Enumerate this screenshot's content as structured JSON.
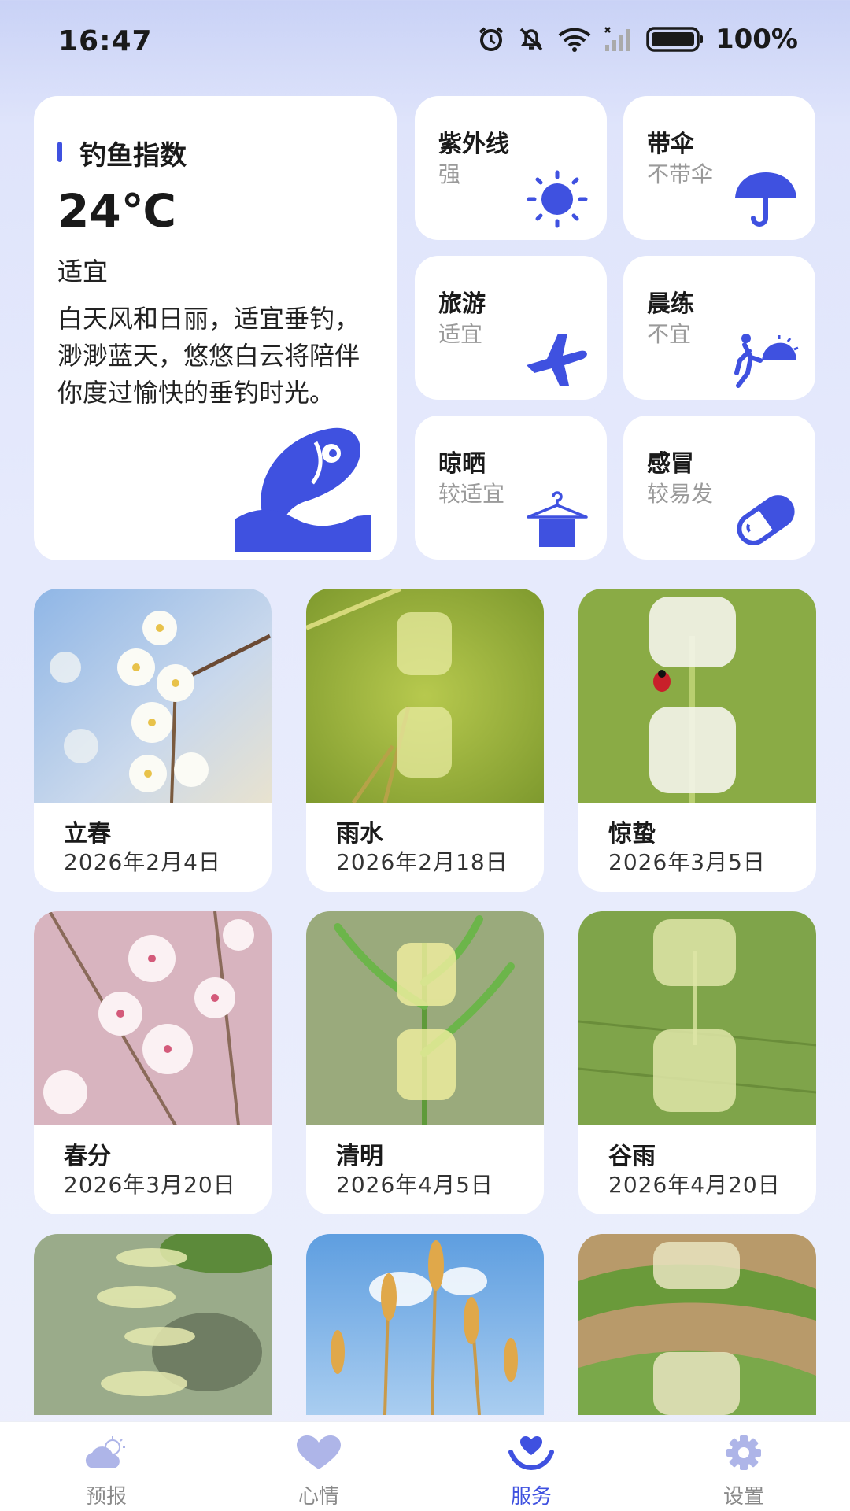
{
  "status_bar": {
    "time": "16:47",
    "battery": "100%",
    "icons": [
      "alarm-icon",
      "mute-icon",
      "wifi-icon",
      "signal-icon",
      "battery-icon"
    ]
  },
  "fishing": {
    "title": "钓鱼指数",
    "temperature": "24℃",
    "level": "适宜",
    "description": "白天风和日丽，适宜垂钓，渺渺蓝天，悠悠白云将陪伴你度过愉快的垂钓时光。",
    "icon": "fish-icon"
  },
  "indices": [
    {
      "title": "紫外线",
      "value": "强",
      "icon": "sun-icon"
    },
    {
      "title": "带伞",
      "value": "不带伞",
      "icon": "umbrella-icon"
    },
    {
      "title": "旅游",
      "value": "适宜",
      "icon": "airplane-icon"
    },
    {
      "title": "晨练",
      "value": "不宜",
      "icon": "running-icon"
    },
    {
      "title": "晾晒",
      "value": "较适宜",
      "icon": "hanger-icon"
    },
    {
      "title": "感冒",
      "value": "较易发",
      "icon": "pill-icon"
    }
  ],
  "solar_terms": [
    {
      "name": "立春",
      "date": "2026年2月4日"
    },
    {
      "name": "雨水",
      "date": "2026年2月18日"
    },
    {
      "name": "惊蛰",
      "date": "2026年3月5日"
    },
    {
      "name": "春分",
      "date": "2026年3月20日"
    },
    {
      "name": "清明",
      "date": "2026年4月5日"
    },
    {
      "name": "谷雨",
      "date": "2026年4月20日"
    }
  ],
  "nav": [
    {
      "label": "预报",
      "icon": "cloud-sun-icon",
      "active": false
    },
    {
      "label": "心情",
      "icon": "heart-icon",
      "active": false
    },
    {
      "label": "服务",
      "icon": "service-icon",
      "active": true
    },
    {
      "label": "设置",
      "icon": "gear-icon",
      "active": false
    }
  ],
  "colors": {
    "accent": "#3f51e0",
    "inactive": "#8a8a8a",
    "background": "#e6eafc"
  }
}
